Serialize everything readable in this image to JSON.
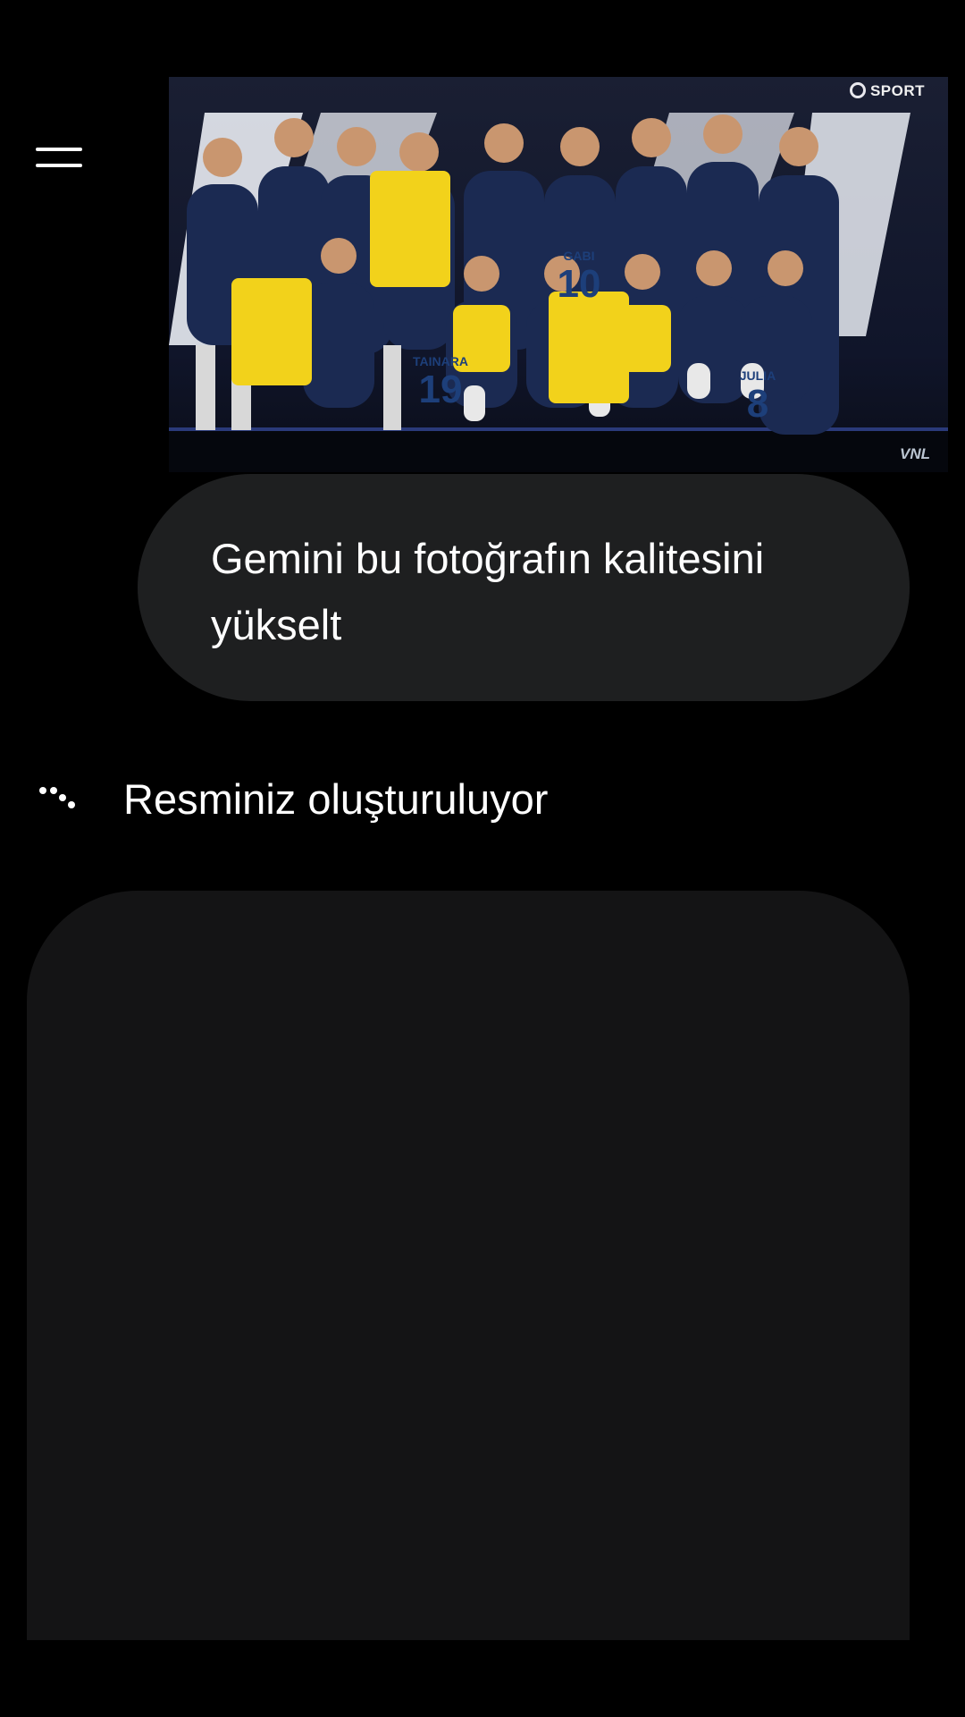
{
  "icons": {
    "menu": "hamburger-menu-icon",
    "status": "loading-dots-icon"
  },
  "photo": {
    "broadcaster": "SPORT",
    "league": "VNL",
    "jerseys": [
      {
        "name": "TAINARA",
        "number": "19"
      },
      {
        "name": "GABI",
        "number": "10"
      },
      {
        "name": "JULIA",
        "number": "8"
      }
    ]
  },
  "prompt": {
    "text": "Gemini bu fotoğrafın kalitesini yükselt"
  },
  "status": {
    "text": "Resminiz oluşturuluyor"
  },
  "colors": {
    "background": "#000000",
    "bubble": "#1e1f20",
    "placeholder": "#141415",
    "jersey_yellow": "#f2d21b",
    "uniform_navy": "#1b2a52"
  }
}
